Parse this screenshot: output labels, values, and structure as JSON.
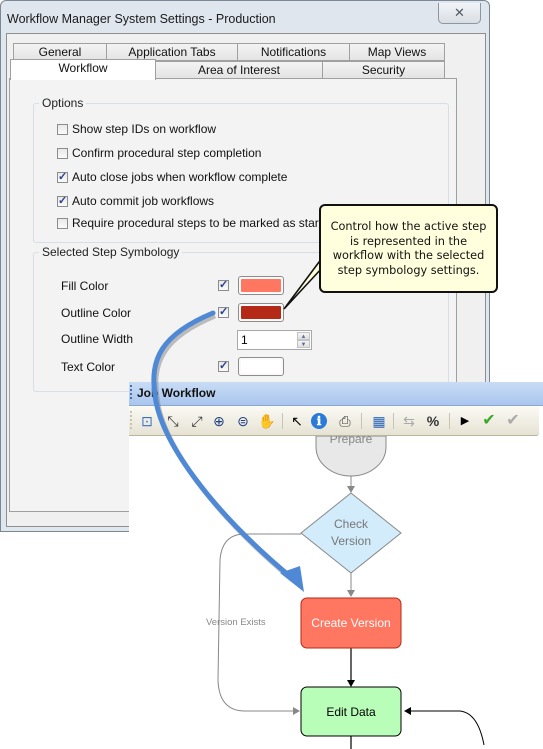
{
  "dialog": {
    "title": "Workflow Manager System Settings - Production",
    "close_icon": "close-icon",
    "tabs_row1": [
      "General",
      "Application Tabs",
      "Notifications",
      "Map Views"
    ],
    "tabs_row2": [
      "Workflow",
      "Area of Interest",
      "Security"
    ],
    "active_tab": "Workflow",
    "options": {
      "legend": "Options",
      "items": [
        {
          "label": "Show step IDs on workflow",
          "checked": false
        },
        {
          "label": "Confirm procedural step completion",
          "checked": false
        },
        {
          "label": "Auto close jobs when workflow complete",
          "checked": true
        },
        {
          "label": "Auto commit job workflows",
          "checked": true
        },
        {
          "label": "Require procedural steps to be marked as started",
          "checked": false
        }
      ]
    },
    "symbology": {
      "legend": "Selected Step Symbology",
      "fill_color": {
        "label": "Fill Color",
        "enabled": true,
        "color": "#ff7661"
      },
      "outline_color": {
        "label": "Outline Color",
        "enabled": true,
        "color": "#b52a16"
      },
      "outline_width": {
        "label": "Outline Width",
        "value": "1"
      },
      "text_color": {
        "label": "Text Color",
        "enabled": true,
        "color": "#ffffff"
      }
    }
  },
  "callout": {
    "lines": [
      "Control how the active step",
      "is represented in the",
      "workflow with the selected",
      "step symbology settings."
    ]
  },
  "job_workflow": {
    "title": "Job Workflow",
    "toolbar": [
      {
        "name": "pan-center-icon",
        "glyph": "⊡"
      },
      {
        "name": "zoom-fit-in-icon",
        "glyph": "⤡"
      },
      {
        "name": "zoom-fit-out-icon",
        "glyph": "⤢"
      },
      {
        "name": "zoom-in-icon",
        "glyph": "⊕"
      },
      {
        "name": "zoom-extent-icon",
        "glyph": "⊜"
      },
      {
        "name": "pan-hand-icon",
        "glyph": "✋"
      },
      {
        "name": "select-pointer-icon",
        "glyph": "↖"
      },
      {
        "name": "info-icon",
        "glyph": "ℹ"
      },
      {
        "name": "print-icon",
        "glyph": "⎙"
      },
      {
        "name": "overview-icon",
        "glyph": "▦"
      },
      {
        "name": "reassign-icon",
        "glyph": "⇆"
      },
      {
        "name": "percent-complete-icon",
        "glyph": "%"
      },
      {
        "name": "run-step-icon",
        "glyph": "▶"
      },
      {
        "name": "mark-complete-icon",
        "glyph": "✔"
      },
      {
        "name": "mark-complete-disabled-icon",
        "glyph": "✔"
      }
    ],
    "nodes": {
      "prepare": {
        "label": "Prepare",
        "fill": "#e8e8e8"
      },
      "check_version": {
        "label_lines": [
          "Check",
          "Version"
        ],
        "fill": "#d2ecfb"
      },
      "create_version": {
        "label": "Create Version",
        "fill": "#ff7661",
        "outline": "#b52a16",
        "text": "#ffffff"
      },
      "edit_data": {
        "label": "Edit Data",
        "fill": "#b8fdb8"
      }
    },
    "edge_labels": {
      "version_exists": "Version Exists"
    }
  }
}
